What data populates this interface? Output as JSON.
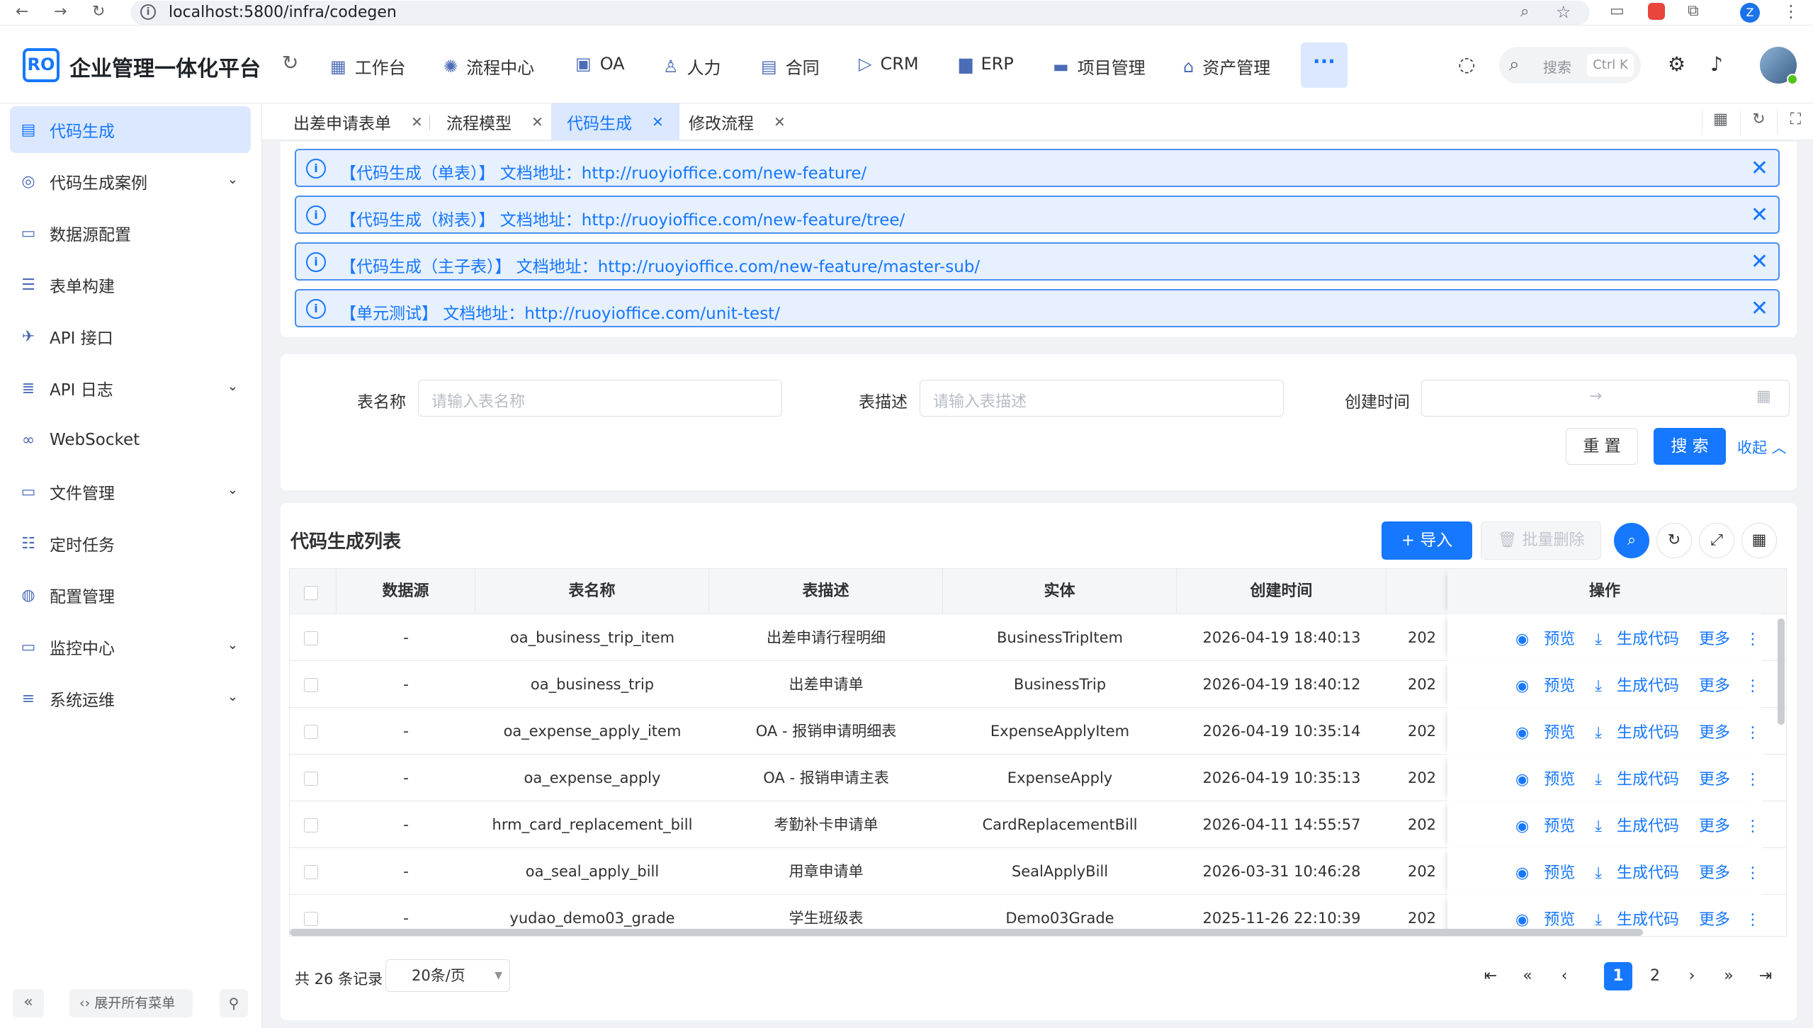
{
  "browser": {
    "url": "localhost:5800/infra/codegen",
    "profile_initial": "Z"
  },
  "header": {
    "logo_text": "RO",
    "title": "企业管理一体化平台",
    "menus": [
      {
        "label": "工作台",
        "icon": "dashboard-icon"
      },
      {
        "label": "流程中心",
        "icon": "flow-icon"
      },
      {
        "label": "OA",
        "icon": "oa-icon"
      },
      {
        "label": "人力",
        "icon": "user-icon"
      },
      {
        "label": "合同",
        "icon": "contract-icon"
      },
      {
        "label": "CRM",
        "icon": "crm-icon"
      },
      {
        "label": "ERP",
        "icon": "erp-icon"
      },
      {
        "label": "项目管理",
        "icon": "project-icon"
      },
      {
        "label": "资产管理",
        "icon": "asset-icon"
      }
    ],
    "more_label": "···",
    "search_placeholder": "搜索",
    "search_shortcut": "Ctrl K"
  },
  "sidebar": {
    "items": [
      {
        "label": "代码生成",
        "icon": "code-icon",
        "active": true,
        "expandable": false
      },
      {
        "label": "代码生成案例",
        "icon": "example-icon",
        "active": false,
        "expandable": true
      },
      {
        "label": "数据源配置",
        "icon": "datasource-icon",
        "active": false,
        "expandable": false
      },
      {
        "label": "表单构建",
        "icon": "form-icon",
        "active": false,
        "expandable": false
      },
      {
        "label": "API 接口",
        "icon": "api-icon",
        "active": false,
        "expandable": false
      },
      {
        "label": "API 日志",
        "icon": "log-icon",
        "active": false,
        "expandable": true
      },
      {
        "label": "WebSocket",
        "icon": "websocket-icon",
        "active": false,
        "expandable": false
      },
      {
        "label": "文件管理",
        "icon": "file-icon",
        "active": false,
        "expandable": true
      },
      {
        "label": "定时任务",
        "icon": "task-icon",
        "active": false,
        "expandable": false
      },
      {
        "label": "配置管理",
        "icon": "config-icon",
        "active": false,
        "expandable": false
      },
      {
        "label": "监控中心",
        "icon": "monitor-icon",
        "active": false,
        "expandable": true
      },
      {
        "label": "系统运维",
        "icon": "ops-icon",
        "active": false,
        "expandable": true
      }
    ],
    "expand_all_label": "展开所有菜单"
  },
  "tabs": [
    {
      "label": "出差申请表单",
      "active": false
    },
    {
      "label": "流程模型",
      "active": false
    },
    {
      "label": "代码生成",
      "active": true
    },
    {
      "label": "修改流程",
      "active": false
    }
  ],
  "alerts": [
    {
      "text": "【代码生成（单表）】 文档地址：http://ruoyioffice.com/new-feature/"
    },
    {
      "text": "【代码生成（树表）】 文档地址：http://ruoyioffice.com/new-feature/tree/"
    },
    {
      "text": "【代码生成（主子表）】 文档地址：http://ruoyioffice.com/new-feature/master-sub/"
    },
    {
      "text": "【单元测试】 文档地址：http://ruoyioffice.com/unit-test/"
    }
  ],
  "search_form": {
    "table_name_label": "表名称",
    "table_name_placeholder": "请输入表名称",
    "table_desc_label": "表描述",
    "table_desc_placeholder": "请输入表描述",
    "created_label": "创建时间",
    "range_separator": "→",
    "reset_label": "重 置",
    "search_label": "搜 索",
    "collapse_label": "收起"
  },
  "table": {
    "title": "代码生成列表",
    "import_label": "+ 导入",
    "batch_delete_label": "批量删除",
    "columns": [
      "数据源",
      "表名称",
      "表描述",
      "实体",
      "创建时间"
    ],
    "ops_header": "操作",
    "op_preview": "预览",
    "op_generate": "生成代码",
    "op_more": "更多",
    "rows": [
      {
        "source": "-",
        "name": "oa_business_trip_item",
        "desc": "出差申请行程明细",
        "entity": "BusinessTripItem",
        "created": "2026-04-19 18:40:13",
        "extra": "202"
      },
      {
        "source": "-",
        "name": "oa_business_trip",
        "desc": "出差申请单",
        "entity": "BusinessTrip",
        "created": "2026-04-19 18:40:12",
        "extra": "202"
      },
      {
        "source": "-",
        "name": "oa_expense_apply_item",
        "desc": "OA - 报销申请明细表",
        "entity": "ExpenseApplyItem",
        "created": "2026-04-19 10:35:14",
        "extra": "202"
      },
      {
        "source": "-",
        "name": "oa_expense_apply",
        "desc": "OA - 报销申请主表",
        "entity": "ExpenseApply",
        "created": "2026-04-19 10:35:13",
        "extra": "202"
      },
      {
        "source": "-",
        "name": "hrm_card_replacement_bill",
        "desc": "考勤补卡申请单",
        "entity": "CardReplacementBill",
        "created": "2026-04-11 14:55:57",
        "extra": "202"
      },
      {
        "source": "-",
        "name": "oa_seal_apply_bill",
        "desc": "用章申请单",
        "entity": "SealApplyBill",
        "created": "2026-03-31 10:46:28",
        "extra": "202"
      },
      {
        "source": "-",
        "name": "yudao_demo03_grade",
        "desc": "学生班级表",
        "entity": "Demo03Grade",
        "created": "2025-11-26 22:10:39",
        "extra": "202"
      }
    ],
    "total_label": "共 26 条记录",
    "page_size_label": "20条/页",
    "pages": [
      "1",
      "2"
    ],
    "current_page": "1"
  }
}
